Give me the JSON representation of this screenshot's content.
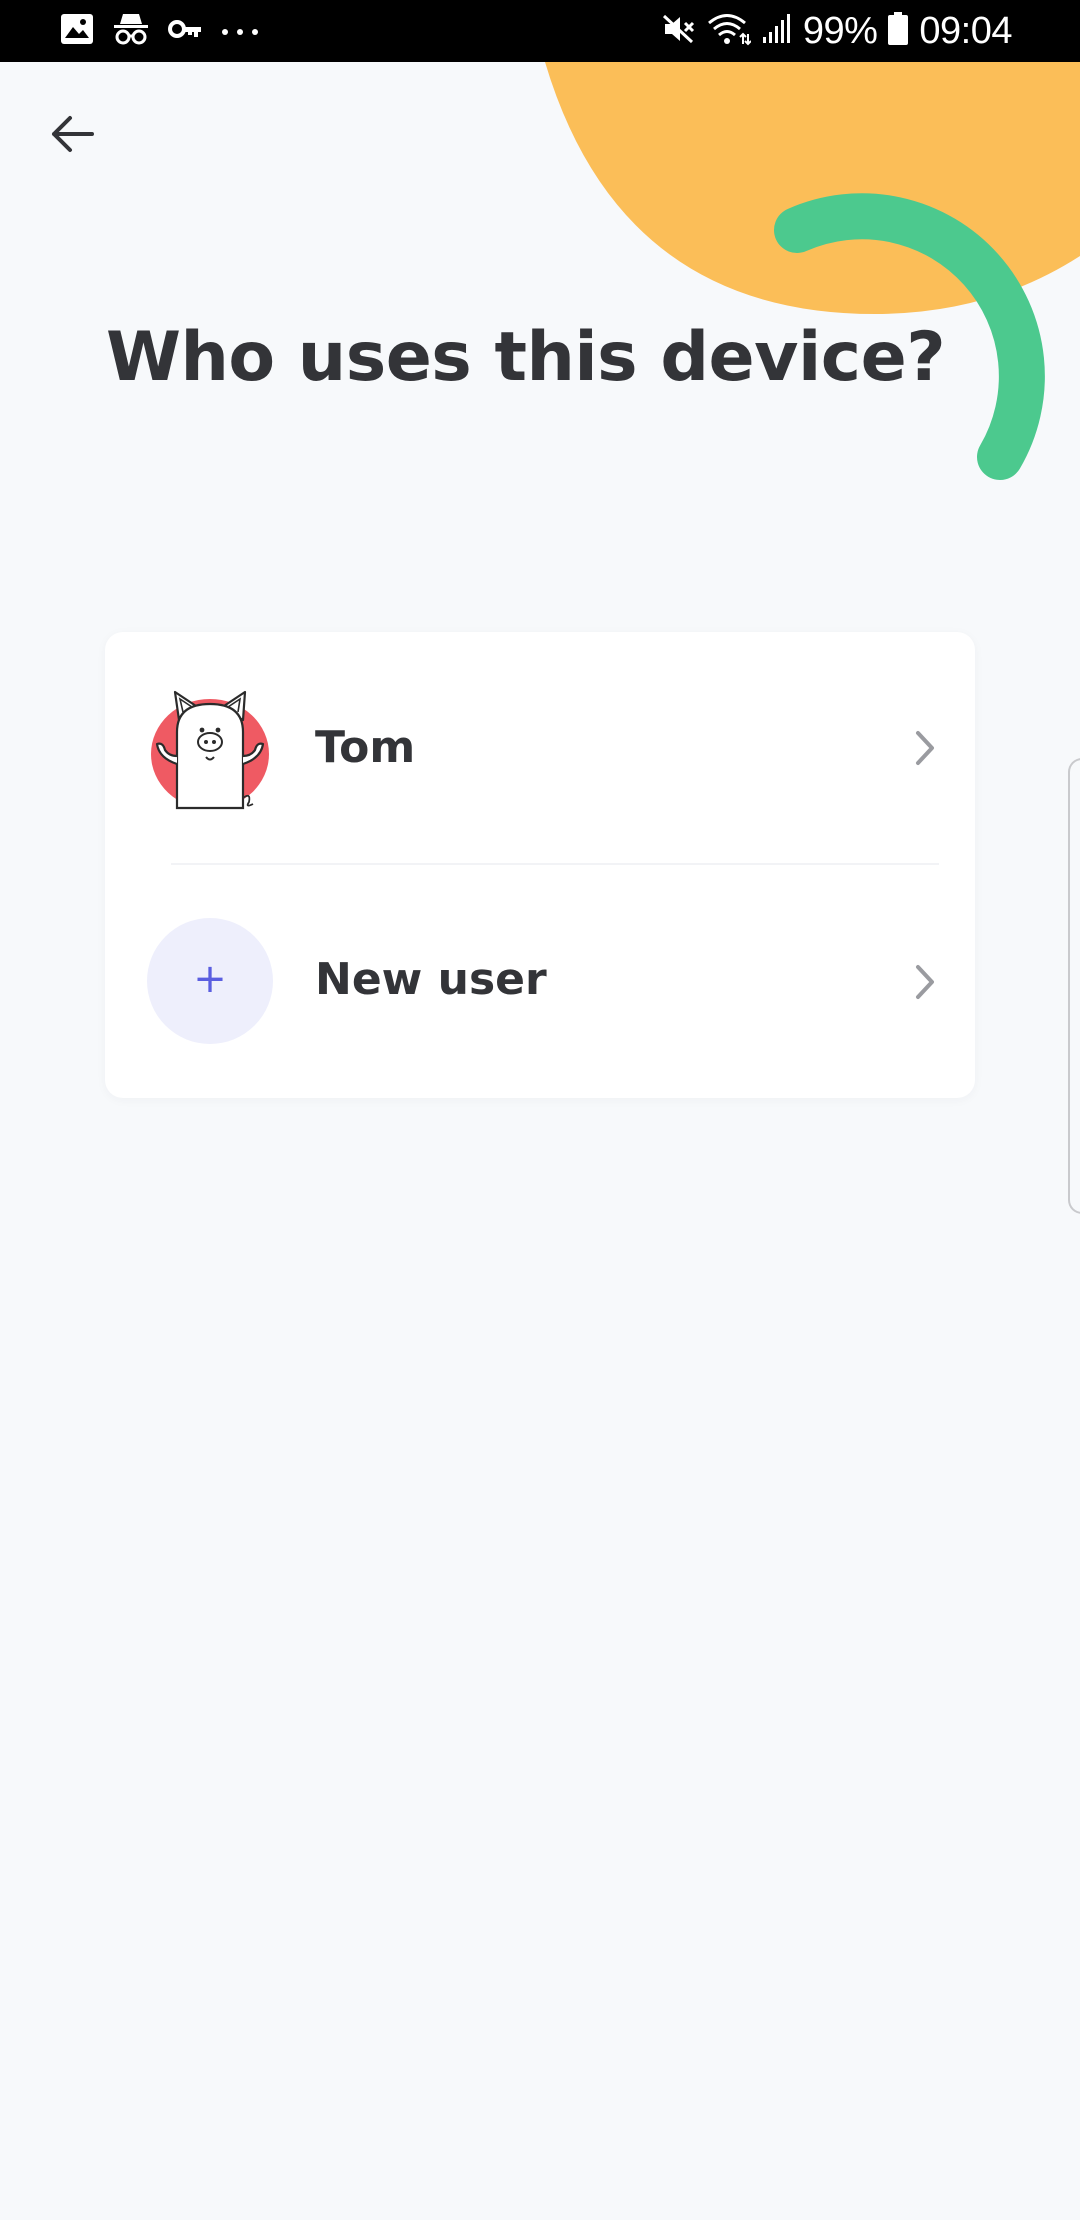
{
  "status_bar": {
    "battery_percent": "99%",
    "time": "09:04",
    "left_icons": [
      "gallery-icon",
      "incognito-icon",
      "vpn-key-icon",
      "more-dots-icon"
    ],
    "right_icons": [
      "mute-icon",
      "wifi-icon",
      "signal-icon",
      "battery-icon"
    ]
  },
  "header": {
    "back_icon": "arrow-left-icon",
    "title": "Who uses this device?"
  },
  "users": {
    "items": [
      {
        "label": "Tom",
        "avatar": "pig-avatar-icon"
      },
      {
        "label": "New user",
        "avatar": "plus-icon",
        "plus_symbol": "+"
      }
    ]
  },
  "colors": {
    "background": "#f7f9fb",
    "accent_yellow": "#fbbe58",
    "accent_green": "#4cc98e",
    "avatar_red": "#ef5a63",
    "new_user_circle": "#eeeffc",
    "plus_color": "#5a5ee0",
    "text": "#333438"
  }
}
